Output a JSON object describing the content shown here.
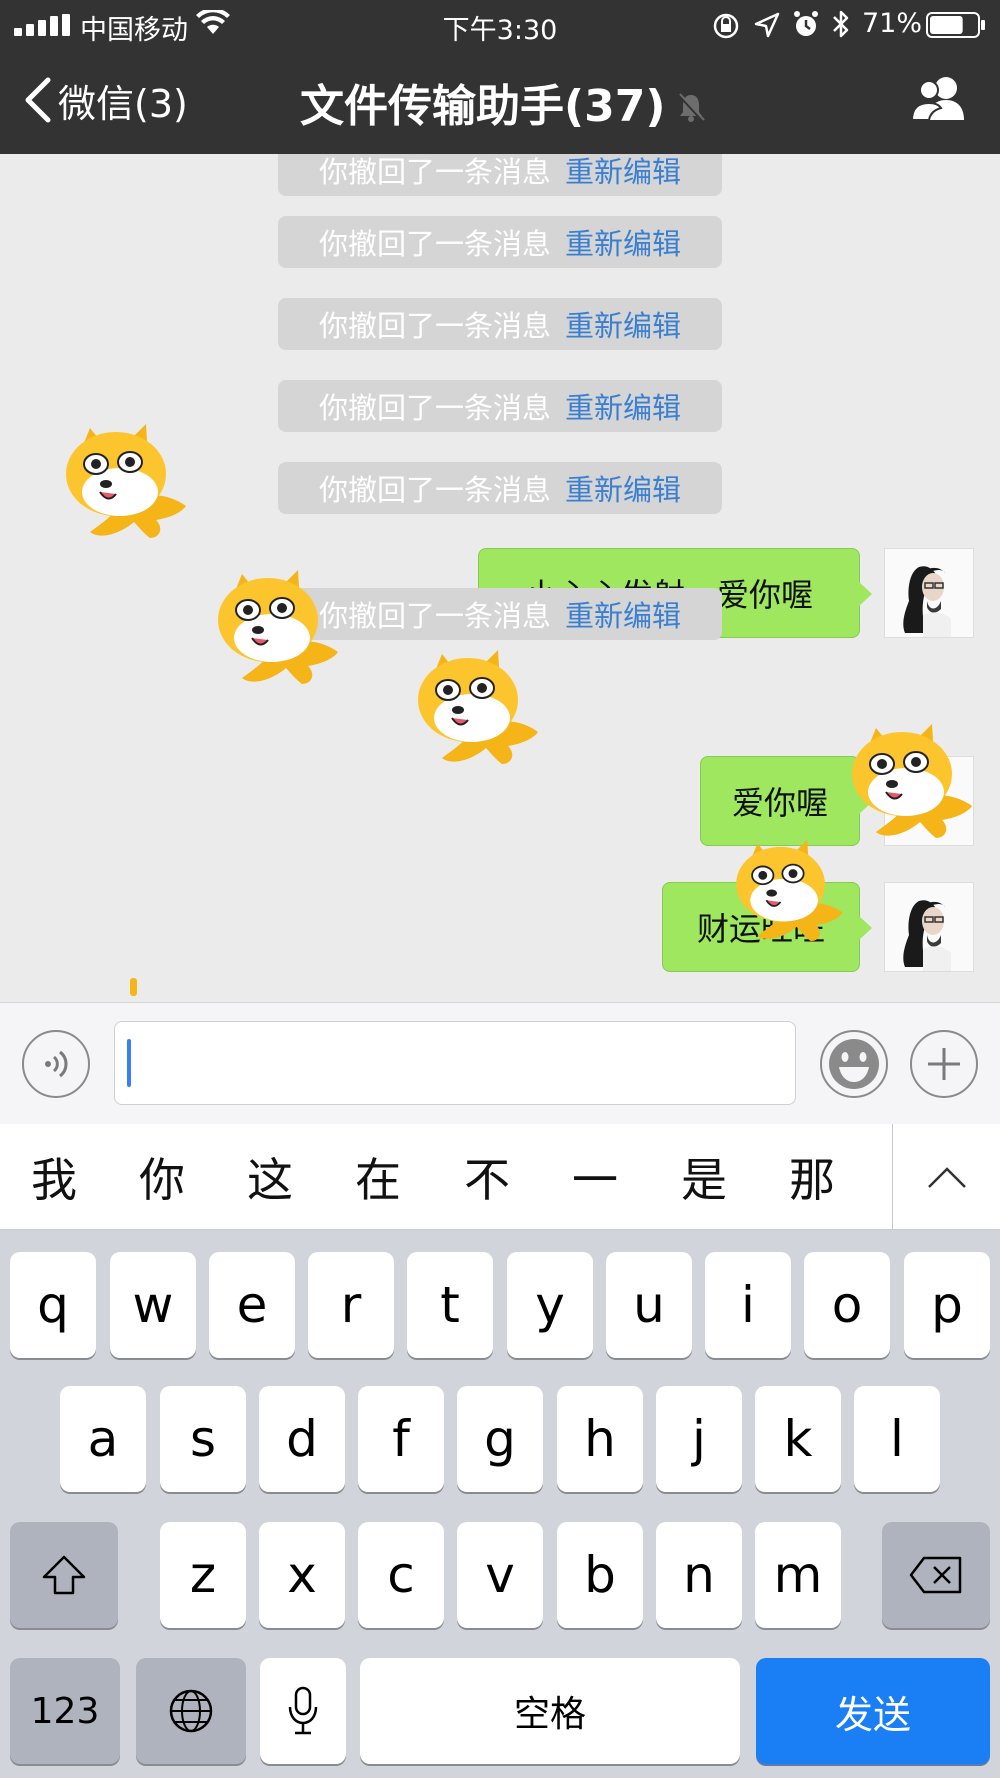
{
  "status_bar": {
    "carrier": "中国移动",
    "time": "下午3:30",
    "battery_percent": "71%",
    "battery_level": 0.71,
    "icons": [
      "signal-icon",
      "wifi-icon",
      "orientation-lock-icon",
      "location-icon",
      "alarm-icon",
      "bluetooth-icon",
      "battery-icon"
    ]
  },
  "nav": {
    "back_label": "微信(3)",
    "title": "文件传输助手(37)",
    "mute_icon": "bell-muted-icon",
    "right_icon": "contacts-icon"
  },
  "chat": {
    "recall_text": "你撤回了一条消息",
    "recall_link": "重新编辑",
    "messages": [
      {
        "type": "recall"
      },
      {
        "type": "recall"
      },
      {
        "type": "recall"
      },
      {
        "type": "recall"
      },
      {
        "type": "recall"
      },
      {
        "type": "text",
        "text": "小心心发射，爱你喔"
      },
      {
        "type": "recall"
      },
      {
        "type": "text",
        "text": "爱你喔"
      },
      {
        "type": "text",
        "text": "财运旺旺"
      }
    ]
  },
  "input_bar": {
    "voice_icon": "voice-icon",
    "emoji_icon": "emoji-icon",
    "plus_icon": "plus-icon",
    "value": ""
  },
  "candidates": [
    "我",
    "你",
    "这",
    "在",
    "不",
    "一",
    "是",
    "那"
  ],
  "keyboard": {
    "row1": [
      "q",
      "w",
      "e",
      "r",
      "t",
      "y",
      "u",
      "i",
      "o",
      "p"
    ],
    "row2": [
      "a",
      "s",
      "d",
      "f",
      "g",
      "h",
      "j",
      "k",
      "l"
    ],
    "row3": [
      "z",
      "x",
      "c",
      "v",
      "b",
      "n",
      "m"
    ],
    "numbers_label": "123",
    "space_label": "空格",
    "send_label": "发送"
  },
  "colors": {
    "nav_bg": "#333333",
    "bubble": "#9ee75f",
    "link": "#3b7fd1",
    "send": "#1a7ef5"
  }
}
